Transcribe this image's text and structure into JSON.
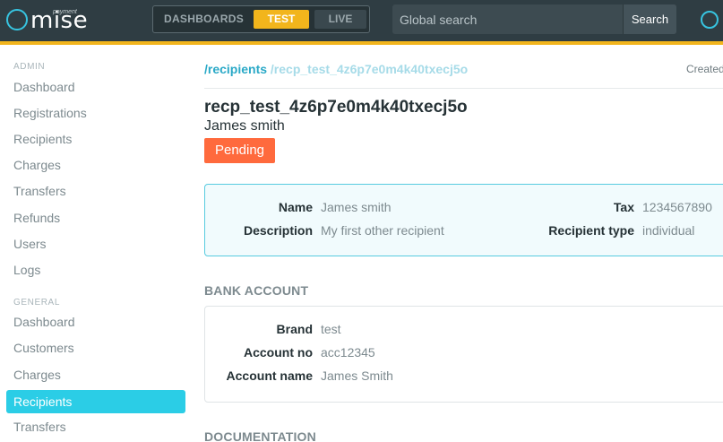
{
  "brand": {
    "logo_text": "mise",
    "logo_sub": "payment"
  },
  "modes": {
    "dashboards": "DASHBOARDS",
    "test": "TEST",
    "live": "LIVE",
    "active": "TEST"
  },
  "search": {
    "placeholder": "Global search",
    "button": "Search"
  },
  "sidebar": {
    "admin_heading": "ADMIN",
    "admin_items": [
      "Dashboard",
      "Registrations",
      "Recipients",
      "Charges",
      "Transfers",
      "Refunds",
      "Users",
      "Logs"
    ],
    "general_heading": "GENERAL",
    "general_items": [
      "Dashboard",
      "Customers",
      "Charges",
      "Recipients",
      "Transfers"
    ],
    "active_item": "Recipients"
  },
  "main": {
    "breadcrumb_root": "/recipients",
    "breadcrumb_id": "/recp_test_4z6p7e0m4k40txecj5o",
    "created_label": "Created",
    "recipient_id": "recp_test_4z6p7e0m4k40txecj5o",
    "recipient_name": "James smith",
    "status": "Pending",
    "status_color": "#ff6a3d",
    "info": {
      "name_label": "Name",
      "name_value": "James smith",
      "description_label": "Description",
      "description_value": "My first other recipient",
      "tax_label": "Tax",
      "tax_value": "1234567890",
      "type_label": "Recipient type",
      "type_value": "individual"
    },
    "bank_heading": "BANK ACCOUNT",
    "bank": {
      "brand_label": "Brand",
      "brand_value": "test",
      "account_no_label": "Account no",
      "account_no_value": "acc12345",
      "account_name_label": "Account name",
      "account_name_value": "James Smith"
    },
    "documentation_heading": "DOCUMENTATION"
  },
  "colors": {
    "accent": "#f2b51c",
    "brand": "#2bcde6",
    "topbar": "#2f3d43"
  }
}
